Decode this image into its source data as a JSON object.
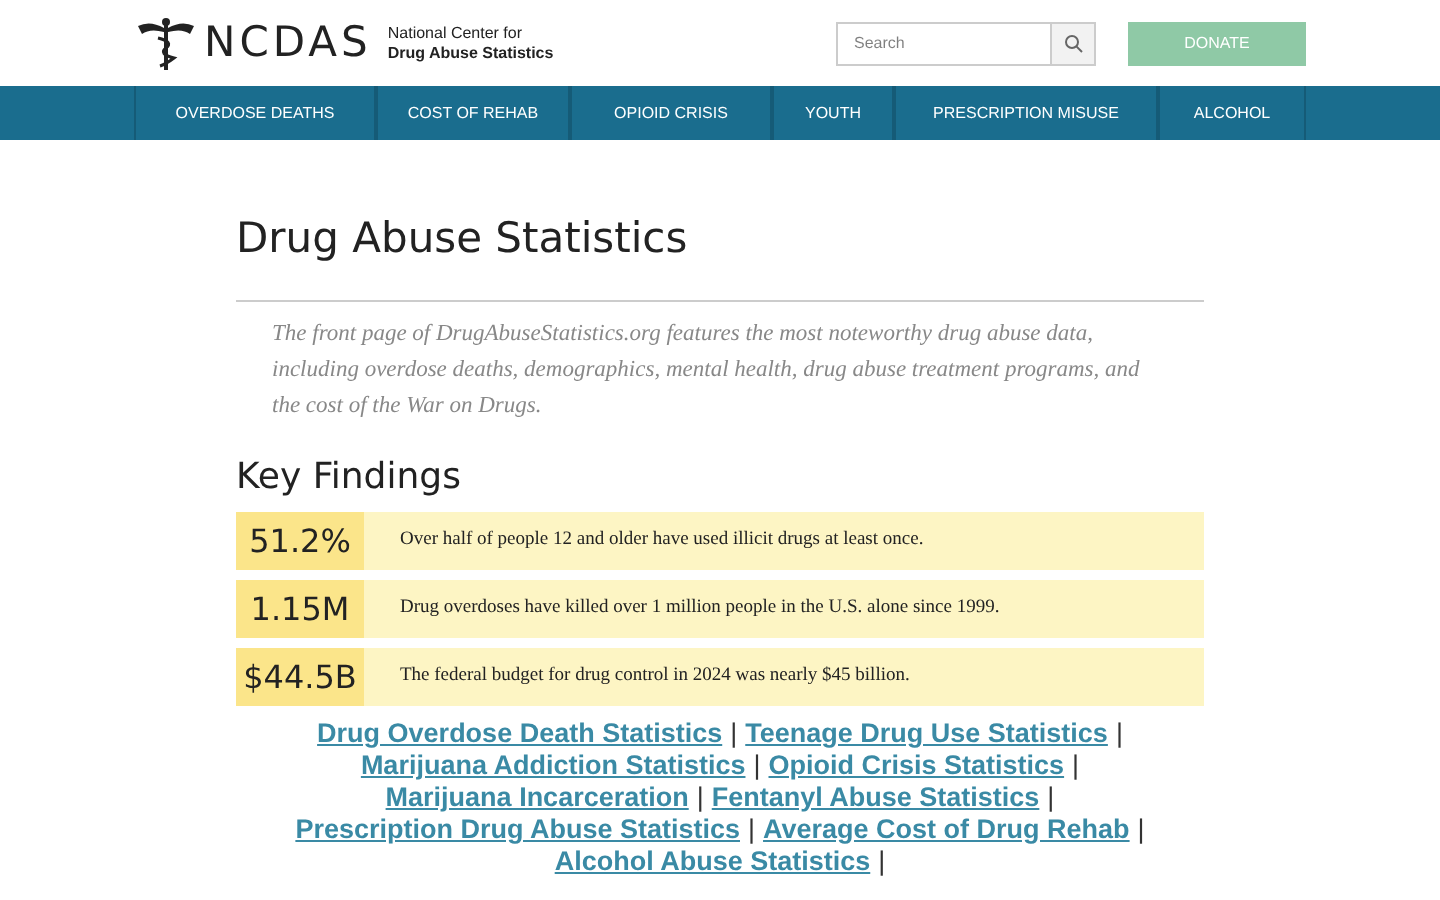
{
  "header": {
    "logo_text": "NCDAS",
    "org_line_1": "National Center for",
    "org_line_2": "Drug Abuse Statistics",
    "search": {
      "placeholder": "Search"
    },
    "donate_button": "DONATE"
  },
  "nav": [
    {
      "label": "OVERDOSE DEATHS"
    },
    {
      "label": "COST OF REHAB"
    },
    {
      "label": "OPIOID CRISIS"
    },
    {
      "label": "YOUTH"
    },
    {
      "label": "PRESCRIPTION MISUSE"
    },
    {
      "label": "ALCOHOL"
    }
  ],
  "title": "Drug Abuse Statistics",
  "intro": "The front page of DrugAbuseStatistics.org features the most noteworthy drug abuse data, including overdose deaths, demographics, mental health, drug abuse treatment programs, and the cost of the War on Drugs.",
  "key_findings": {
    "heading": "Key Findings",
    "items": [
      {
        "figure": "51.2%",
        "text": "Over half of people 12 and older have used illicit drugs at least once."
      },
      {
        "figure": "1.15M",
        "text": "Drug overdoses have killed over 1 million people in the U.S. alone since 1999."
      },
      {
        "figure": "$44.5B",
        "text": "The federal budget for drug control in 2024 was nearly $45 billion."
      }
    ]
  },
  "links": [
    {
      "kind": "link",
      "text": "Drug Overdose Death Statistics"
    },
    {
      "kind": "separator",
      "text": "|"
    },
    {
      "kind": "link",
      "text": "Teenage Drug Use Statistics"
    },
    {
      "kind": "separator",
      "text": "|"
    },
    {
      "kind": "link",
      "text": "Marijuana Addiction Statistics"
    },
    {
      "kind": "separator",
      "text": "|"
    },
    {
      "kind": "link",
      "text": "Opioid Crisis Statistics"
    },
    {
      "kind": "separator",
      "text": "|"
    },
    {
      "kind": "link",
      "text": "Marijuana Incarceration"
    },
    {
      "kind": "separator",
      "text": "|"
    },
    {
      "kind": "link",
      "text": "Fentanyl Abuse Statistics"
    },
    {
      "kind": "separator",
      "text": "|"
    },
    {
      "kind": "link",
      "text": "Prescription Drug Abuse Statistics"
    },
    {
      "kind": "separator",
      "text": "|"
    },
    {
      "kind": "link",
      "text": "Average Cost of Drug Rehab"
    },
    {
      "kind": "separator",
      "text": "|"
    },
    {
      "kind": "link",
      "text": "Alcohol Abuse Statistics"
    },
    {
      "kind": "separator",
      "text": "|"
    }
  ]
}
